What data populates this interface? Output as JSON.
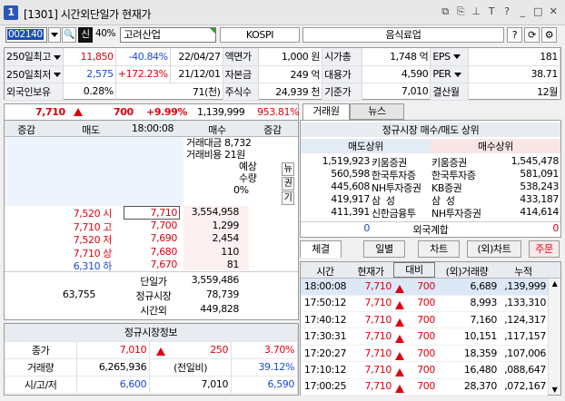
{
  "window": {
    "title": "[1301] 시간외단일가 현재가",
    "icon_label": "1"
  },
  "toolbar": {
    "code": "002140",
    "sin": "신",
    "pct": "40%",
    "name": "고려산업",
    "market": "KOSPI",
    "sector": "음식료업",
    "help": "?"
  },
  "info": {
    "r1": {
      "l1": "250일최고",
      "v1": "11,850",
      "p1": "-40.84%",
      "d1": "22/04/27",
      "l2": "액면가",
      "v2": "1,000 원",
      "l3": "시가총",
      "v3": "1,748 억",
      "l4": "EPS",
      "v4": "181"
    },
    "r2": {
      "l1": "250일최저",
      "v1": "2,575",
      "p1": "+172.23%",
      "d1": "21/12/01",
      "l2": "자본금",
      "v2": "249 억",
      "l3": "대용가",
      "v3": "4,590",
      "l4": "PER",
      "v4": "38.71"
    },
    "r3": {
      "l1": "외국인보유",
      "v1": "0.28%",
      "d1": "71(천)",
      "l2": "주식수",
      "v2": "24,939 천",
      "l3": "기준가",
      "v3": "7,010",
      "l4": "결산월",
      "v4": "12월"
    }
  },
  "price_bar": {
    "price": "7,710",
    "change": "700",
    "rate": "+9.99%",
    "volume": "1,139,999",
    "ratio": "953.81%"
  },
  "orderbook": {
    "headers": [
      "증감",
      "매도",
      "18:00:08",
      "매수",
      "증감"
    ],
    "trade_amount_label": "거래대금",
    "trade_amount": "8,732",
    "trade_cost_label": "거래비용",
    "trade_cost": "21원",
    "expect_label": "예상",
    "qty_label": "수량",
    "expect_pct": "0%",
    "side": [
      "뉴",
      "권",
      "기"
    ],
    "bids": [
      {
        "info": "7,520 시",
        "info_color": "red",
        "price": "7,710",
        "vol": "3,554,958",
        "sel": true
      },
      {
        "info": "7,710 고",
        "info_color": "red",
        "price": "7,700",
        "vol": "1,299"
      },
      {
        "info": "7,520 저",
        "info_color": "red",
        "price": "7,690",
        "vol": "2,454"
      },
      {
        "info": "7,710 상",
        "info_color": "red",
        "price": "7,680",
        "vol": "110"
      },
      {
        "info": "6,310 하",
        "info_color": "blue",
        "price": "7,670",
        "vol": "81"
      }
    ],
    "sum_sell": "63,755",
    "s1_label": "단일가",
    "s1": "3,559,486",
    "s2_label": "정규시장",
    "s2": "78,739",
    "s3_label": "시간외",
    "s3": "449,828"
  },
  "regular": {
    "title": "정규시장정보",
    "r1": {
      "l": "종가",
      "v": "7,010",
      "c": "250",
      "p": "3.70%"
    },
    "r2": {
      "l": "거래량",
      "v": "6,265,936",
      "m": "(전일비)",
      "p": "39.12%"
    },
    "r3": {
      "l": "시/고/저",
      "a": "6,600",
      "b": "7,010",
      "c": "6,590"
    }
  },
  "tabs": {
    "t1": "거래원",
    "t2": "뉴스"
  },
  "market": {
    "title": "정규시장 매수/매도 상위",
    "sell_h": "매도상위",
    "buy_h": "매수상위",
    "rows": [
      {
        "sv": "1,519,923",
        "sn": "키움증권",
        "bn": "키움증권",
        "bv": "1,545,478"
      },
      {
        "sv": "560,598",
        "sn": "한국투자증",
        "bn": "한국투자증",
        "bv": "581,091"
      },
      {
        "sv": "445,608",
        "sn": "NH투자증권",
        "bn": "KB증권",
        "bv": "538,243"
      },
      {
        "sv": "419,917",
        "sn": "삼  성",
        "bn": "삼  성",
        "bv": "433,187"
      },
      {
        "sv": "411,391",
        "sn": "신한금융투",
        "bn": "NH투자증권",
        "bv": "414,614"
      }
    ],
    "foreign_l": "0",
    "foreign": "외국계합",
    "foreign_r": "0"
  },
  "tabs2": [
    "체결",
    "일별",
    "차트",
    "(외)차트",
    "주문"
  ],
  "ticks": {
    "headers": [
      "시간",
      "현재가",
      "대비",
      "(외)거래량",
      "누적"
    ],
    "rows": [
      {
        "t": "18:00:08",
        "p": "7,710",
        "d": "700",
        "v": "6,689",
        "a": ",139,999"
      },
      {
        "t": "17:50:12",
        "p": "7,710",
        "d": "700",
        "v": "8,993",
        "a": ",133,310"
      },
      {
        "t": "17:40:12",
        "p": "7,710",
        "d": "700",
        "v": "7,160",
        "a": ",124,317"
      },
      {
        "t": "17:30:31",
        "p": "7,710",
        "d": "700",
        "v": "10,151",
        "a": ",117,157"
      },
      {
        "t": "17:20:27",
        "p": "7,710",
        "d": "700",
        "v": "18,359",
        "a": ",107,006"
      },
      {
        "t": "17:10:12",
        "p": "7,710",
        "d": "700",
        "v": "16,480",
        "a": ",088,647"
      },
      {
        "t": "17:00:25",
        "p": "7,710",
        "d": "700",
        "v": "28,370",
        "a": ",072,167"
      }
    ]
  }
}
